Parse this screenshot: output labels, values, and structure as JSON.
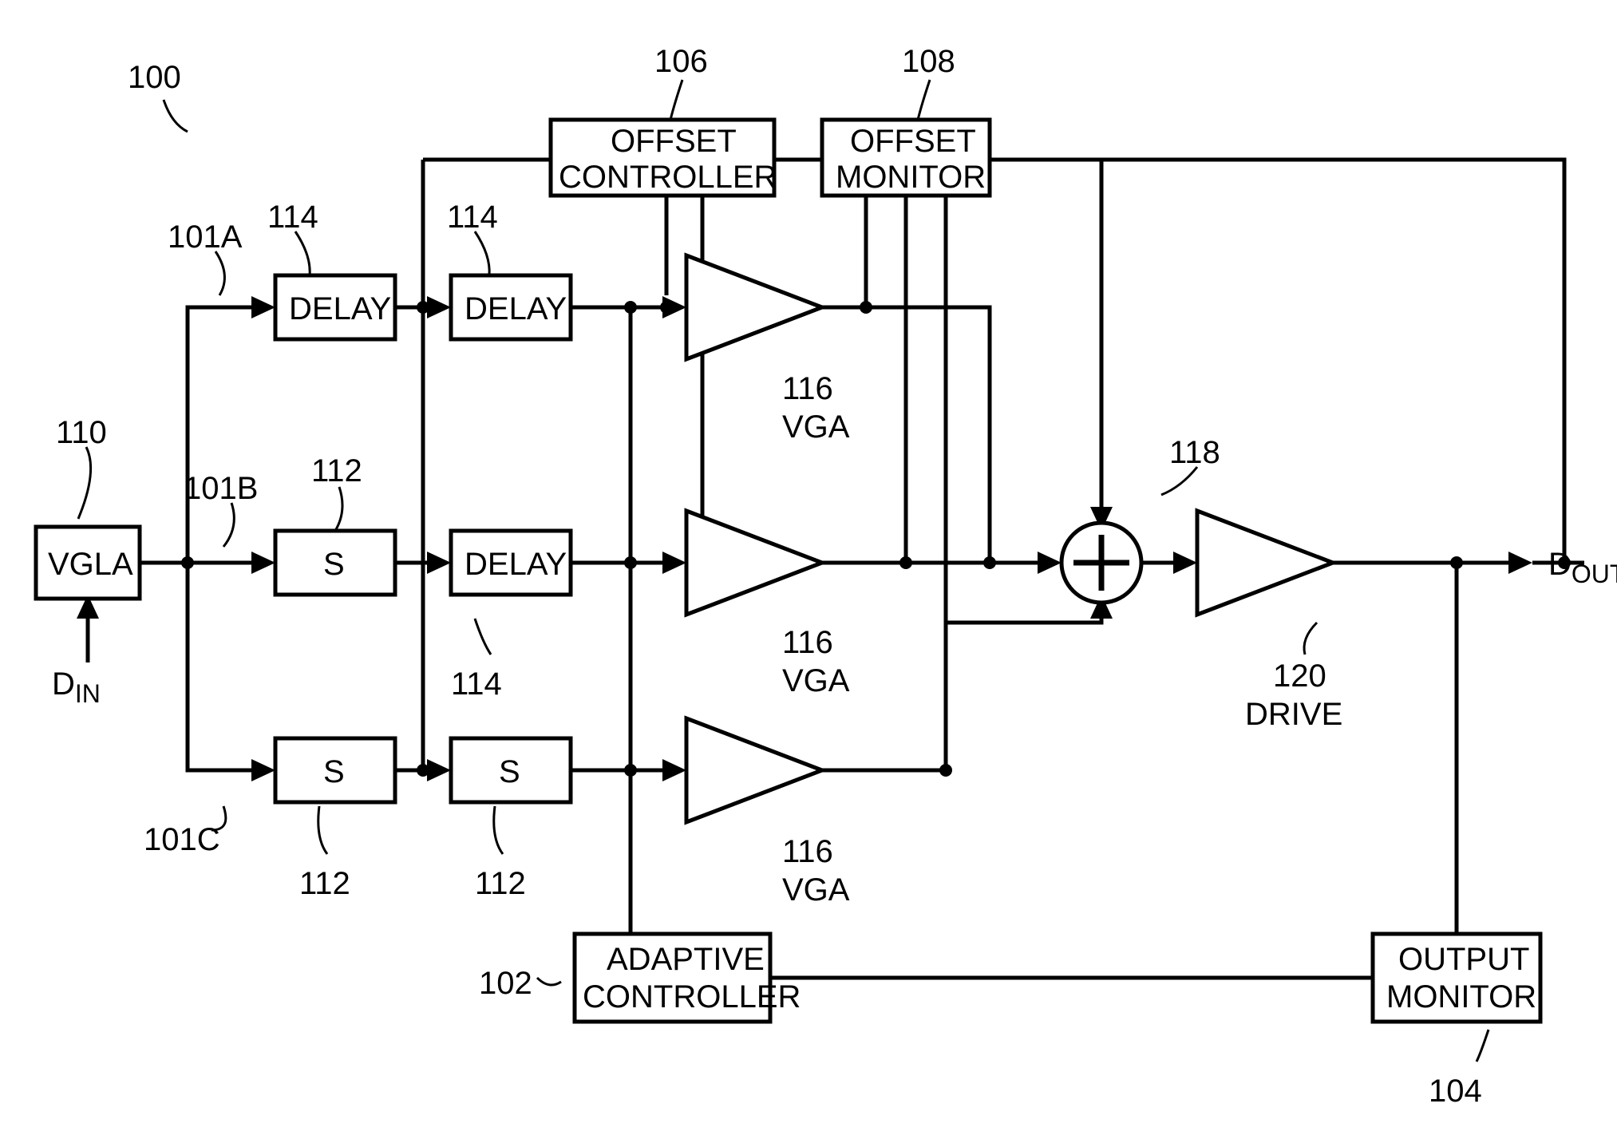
{
  "ref_main": "100",
  "input_label_prefix": "D",
  "input_label_sub": "IN",
  "output_label_prefix": "D",
  "output_label_sub": "OUT",
  "blocks": {
    "vgla": {
      "label": "VGLA",
      "ref": "110"
    },
    "offset_controller": {
      "label_l1": "OFFSET",
      "label_l2": "CONTROLLER",
      "ref": "106"
    },
    "offset_monitor": {
      "label_l1": "OFFSET",
      "label_l2": "MONITOR",
      "ref": "108"
    },
    "adaptive_controller": {
      "label_l1": "ADAPTIVE",
      "label_l2": "CONTROLLER",
      "ref": "102"
    },
    "output_monitor": {
      "label_l1": "OUTPUT",
      "label_l2": "MONITOR",
      "ref": "104"
    },
    "delay_a1": {
      "label": "DELAY",
      "ref": "114"
    },
    "delay_a2": {
      "label": "DELAY",
      "ref": "114"
    },
    "s_b1": {
      "label": "S",
      "ref": "112"
    },
    "delay_b2": {
      "label": "DELAY",
      "ref": "114"
    },
    "s_c1": {
      "label": "S",
      "ref": "112"
    },
    "s_c2": {
      "label": "S",
      "ref": "112"
    },
    "vga_a": {
      "label": "VGA",
      "ref": "116"
    },
    "vga_b": {
      "label": "VGA",
      "ref": "116"
    },
    "vga_c": {
      "label": "VGA",
      "ref": "116"
    },
    "summer": {
      "ref": "118"
    },
    "drive": {
      "label": "DRIVE",
      "ref": "120"
    }
  },
  "paths": {
    "a": "101A",
    "b": "101B",
    "c": "101C"
  }
}
